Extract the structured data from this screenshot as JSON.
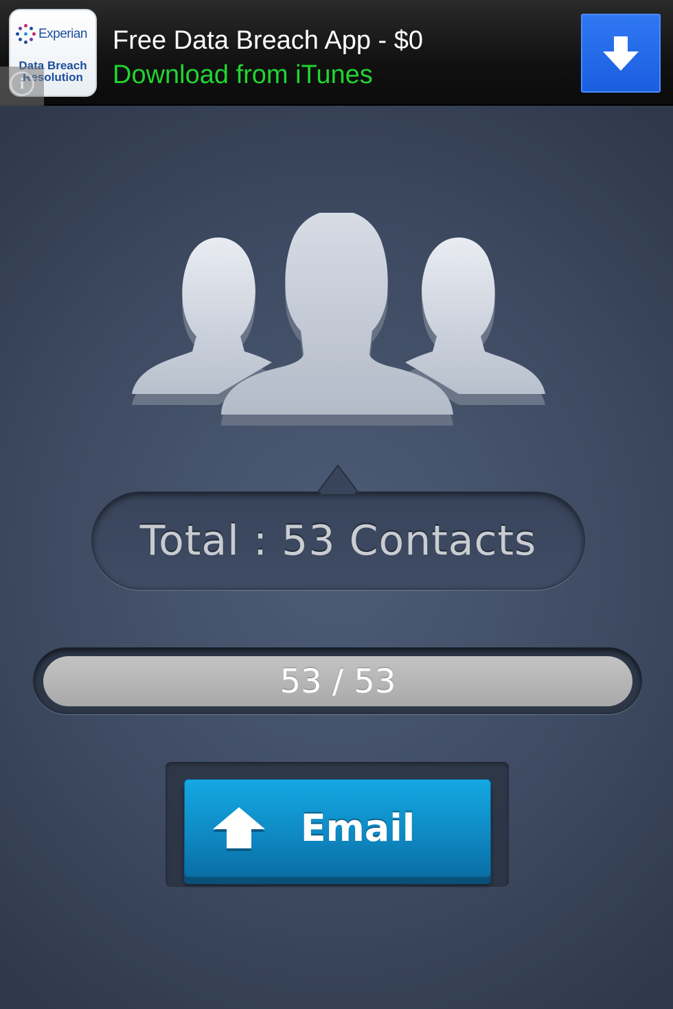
{
  "ad": {
    "logo_brand": "Experian",
    "logo_subtitle_line1": "Data Breach",
    "logo_subtitle_line2": "Resolution",
    "title": "Free Data Breach App - $0",
    "subtitle": "Download from iTunes",
    "info_glyph": "i",
    "download_icon": "arrow-down-icon",
    "colors": {
      "subtitle": "#22d431",
      "download_button": "#1b5ee0",
      "brand": "#1b4f9c"
    }
  },
  "contacts": {
    "icon": "contacts-group-icon",
    "total_text": "Total : 53 Contacts"
  },
  "progress": {
    "text": "53 / 53",
    "current": 53,
    "total": 53
  },
  "email_button": {
    "label": "Email",
    "icon": "upload-arrow-icon",
    "color": "#0f8ac4"
  }
}
